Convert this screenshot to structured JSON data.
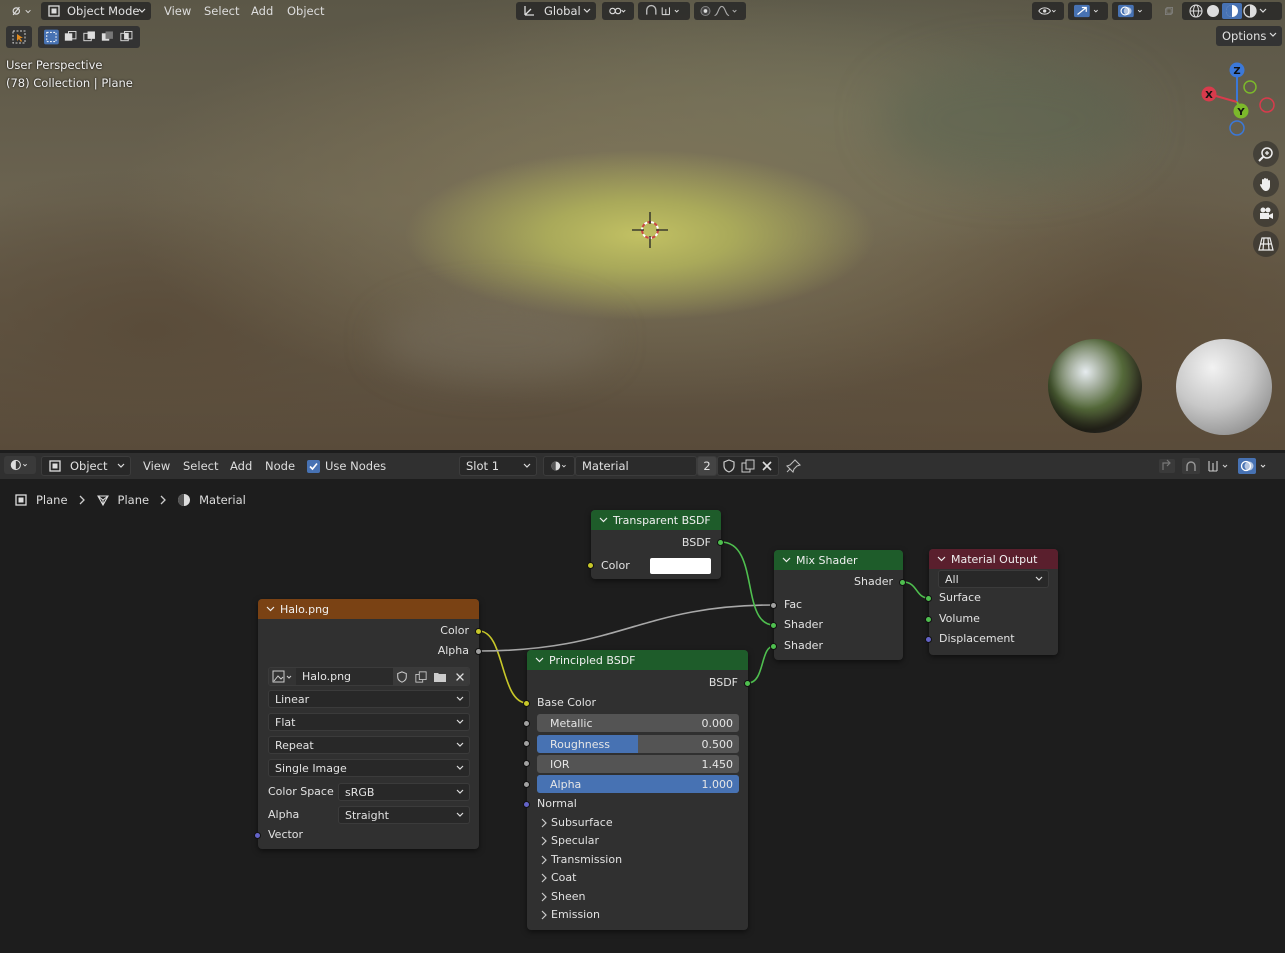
{
  "viewport": {
    "mode": "Object Mode",
    "menu": [
      "View",
      "Select",
      "Add",
      "Object"
    ],
    "transform_orientation": "Global",
    "options_label": "Options",
    "perspective_label": "User Perspective",
    "collection_label": "(78) Collection | Plane",
    "gizmo_axes": {
      "z": "Z",
      "x": "X",
      "y": "Y"
    },
    "icons": [
      "editor-type-icon",
      "object-mode-icon",
      "orientation-icon",
      "pivot-icon",
      "snap-icon",
      "proportional-icon",
      "visibility-icon",
      "gizmo-icon",
      "overlay-icon",
      "xray-icon",
      "wireframe-icon",
      "solid-icon",
      "material-preview-icon",
      "rendered-icon",
      "zoom-icon",
      "hand-icon",
      "camera-icon",
      "grid-icon"
    ]
  },
  "node_editor": {
    "object_dropdown": "Object",
    "menu": [
      "View",
      "Select",
      "Add",
      "Node"
    ],
    "use_nodes_label": "Use Nodes",
    "use_nodes_checked": true,
    "slot": "Slot 1",
    "material_name": "Material",
    "material_users": "2",
    "breadcrumb": [
      "Plane",
      "Plane",
      "Material"
    ]
  },
  "nodes": {
    "transparent": {
      "title": "Transparent BSDF",
      "out": "BSDF",
      "color_label": "Color",
      "header_color": "#1e5c2a"
    },
    "mix": {
      "title": "Mix Shader",
      "out": "Shader",
      "fac": "Fac",
      "shader1": "Shader",
      "shader2": "Shader",
      "header_color": "#1e5c2a"
    },
    "output": {
      "title": "Material Output",
      "target": "All",
      "surface": "Surface",
      "volume": "Volume",
      "displacement": "Displacement",
      "header_color": "#5a1f2d"
    },
    "image": {
      "title": "Halo.png",
      "out_color": "Color",
      "out_alpha": "Alpha",
      "image_name": "Halo.png",
      "interpolation": "Linear",
      "projection": "Flat",
      "extension": "Repeat",
      "source": "Single Image",
      "color_space_label": "Color Space",
      "color_space": "sRGB",
      "alpha_label": "Alpha",
      "alpha_mode": "Straight",
      "vector_label": "Vector",
      "header_color": "#7a4214"
    },
    "principled": {
      "title": "Principled BSDF",
      "out": "BSDF",
      "base_color": "Base Color",
      "metallic_label": "Metallic",
      "metallic": "0.000",
      "metallic_fill": 0,
      "roughness_label": "Roughness",
      "roughness": "0.500",
      "roughness_fill": 0.5,
      "ior_label": "IOR",
      "ior": "1.450",
      "ior_fill": 0,
      "alpha_label": "Alpha",
      "alpha": "1.000",
      "alpha_fill": 1,
      "normal": "Normal",
      "panels": [
        "Subsurface",
        "Specular",
        "Transmission",
        "Coat",
        "Sheen",
        "Emission"
      ],
      "header_color": "#1e5c2a"
    }
  },
  "colors": {
    "socket_color": "#c7c729",
    "socket_shader": "#63c763",
    "socket_float": "#a1a1a1",
    "socket_vector": "#6363c7",
    "accent": "#4772b3"
  }
}
